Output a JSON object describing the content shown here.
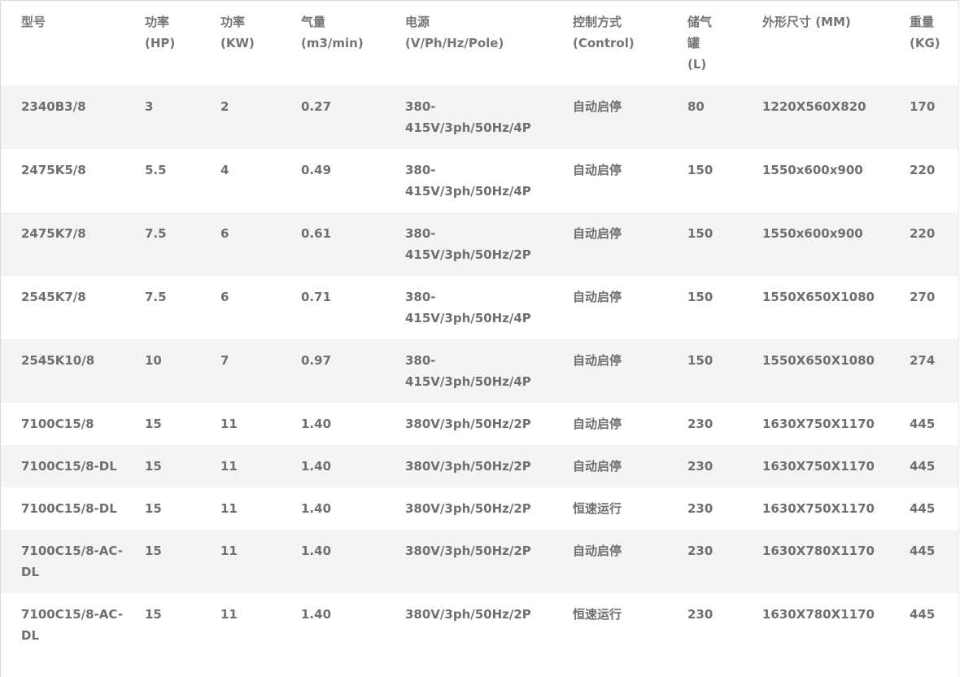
{
  "table": {
    "headers": [
      {
        "line1": "型号",
        "line2": "",
        "line3": ""
      },
      {
        "line1": "功率",
        "line2": "(HP)",
        "line3": ""
      },
      {
        "line1": "功率",
        "line2": "(KW)",
        "line3": ""
      },
      {
        "line1": "气量",
        "line2": "(m3/min)",
        "line3": ""
      },
      {
        "line1": "电源",
        "line2": "(V/Ph/Hz/Pole)",
        "line3": ""
      },
      {
        "line1": "控制方式",
        "line2": "(Control)",
        "line3": ""
      },
      {
        "line1": "储气",
        "line2": "罐",
        "line3": "(L)"
      },
      {
        "line1": "外形尺寸 (MM)",
        "line2": "",
        "line3": ""
      },
      {
        "line1": "重量",
        "line2": "(KG)",
        "line3": ""
      }
    ],
    "rows": [
      [
        "2340B3/8",
        "3",
        "2",
        "0.27",
        "380-415V/3ph/50Hz/4P",
        "自动启停",
        "80",
        "1220X560X820",
        "170"
      ],
      [
        "2475K5/8",
        "5.5",
        "4",
        "0.49",
        "380-415V/3ph/50Hz/4P",
        "自动启停",
        "150",
        "1550x600x900",
        "220"
      ],
      [
        "2475K7/8",
        "7.5",
        "6",
        "0.61",
        "380-415V/3ph/50Hz/2P",
        "自动启停",
        "150",
        "1550x600x900",
        "220"
      ],
      [
        "2545K7/8",
        "7.5",
        "6",
        "0.71",
        "380-415V/3ph/50Hz/4P",
        "自动启停",
        "150",
        "1550X650X1080",
        "270"
      ],
      [
        "2545K10/8",
        "10",
        "7",
        "0.97",
        "380-415V/3ph/50Hz/4P",
        "自动启停",
        "150",
        "1550X650X1080",
        "274"
      ],
      [
        "7100C15/8",
        "15",
        "11",
        "1.40",
        "380V/3ph/50Hz/2P",
        "自动启停",
        "230",
        "1630X750X1170",
        "445"
      ],
      [
        "7100C15/8-DL",
        "15",
        "11",
        "1.40",
        "380V/3ph/50Hz/2P",
        "自动启停",
        "230",
        "1630X750X1170",
        "445"
      ],
      [
        "7100C15/8-DL",
        "15",
        "11",
        "1.40",
        "380V/3ph/50Hz/2P",
        "恒速运行",
        "230",
        "1630X750X1170",
        "445"
      ],
      [
        "7100C15/8-AC-DL",
        "15",
        "11",
        "1.40",
        "380V/3ph/50Hz/2P",
        "自动启停",
        "230",
        "1630X780X1170",
        "445"
      ],
      [
        "7100C15/8-AC-DL",
        "15",
        "11",
        "1.40",
        "380V/3ph/50Hz/2P",
        "恒速运行",
        "230",
        "1630X780X1170",
        "445"
      ]
    ]
  }
}
